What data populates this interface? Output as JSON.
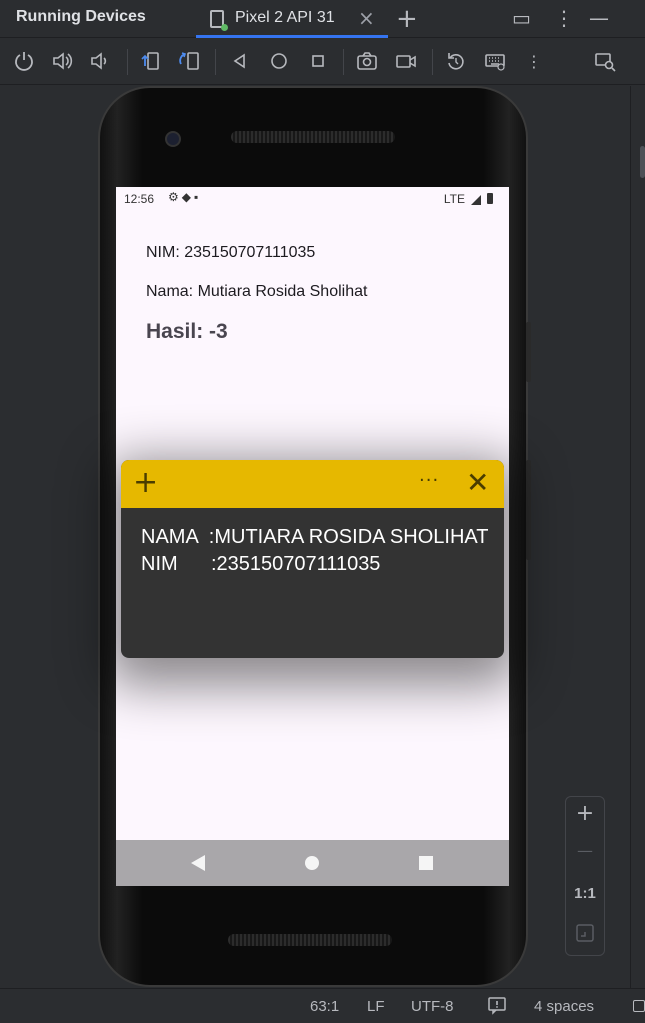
{
  "window": {
    "title": "Running Devices",
    "tab_label": "Pixel 2 API 31",
    "tab_close": "×",
    "add_tab": "+",
    "layout_icon": "▭",
    "more_icon": "⋮",
    "minimize_icon": "—"
  },
  "toolbar": {
    "icons": [
      "power-icon",
      "volume-up-icon",
      "volume-down-icon",
      "rotate-left-icon",
      "rotate-right-icon",
      "back-icon",
      "home-icon",
      "overview-icon",
      "screenshot-icon",
      "screen-record-icon",
      "reset-icon",
      "keyboard-icon",
      "more-vertical-icon",
      "device-manager-icon"
    ]
  },
  "device": {
    "status": {
      "time": "12:56",
      "network": "LTE"
    },
    "app": {
      "nim_line": "NIM: 235150707111035",
      "nama_line": "Nama: Mutiara Rosida Sholihat",
      "hasil_line": "Hasil: -3"
    }
  },
  "sticky_note": {
    "add": "+",
    "more": "···",
    "close": "✕",
    "body": "NAMA  :MUTIARA ROSIDA SHOLIHAT\nNIM      :235150707111035"
  },
  "zoom": {
    "plus": "+",
    "minus": "—",
    "ratio": "1:1"
  },
  "statusline": {
    "position": "63:1",
    "line_sep": "LF",
    "encoding": "UTF-8",
    "indent": "4 spaces"
  },
  "colors": {
    "ide_bg": "#2b2d30",
    "sticky_header": "#e6b800",
    "sticky_body": "#333333",
    "screen_bg": "#fdf7fe",
    "tab_underline": "#3574f0"
  }
}
